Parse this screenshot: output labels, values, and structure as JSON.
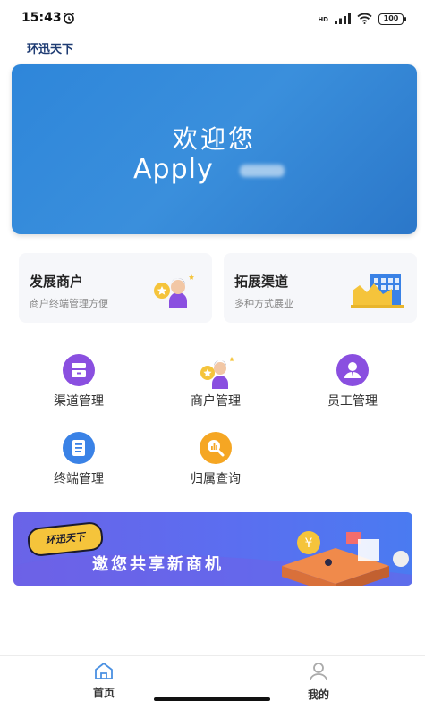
{
  "status_bar": {
    "time": "15:43",
    "network": "HD",
    "battery": "100"
  },
  "app": {
    "title": "环迅天下"
  },
  "hero": {
    "title": "欢迎您",
    "subtitle": "Apply"
  },
  "cards": [
    {
      "title": "发展商户",
      "desc": "商户终端管理方便",
      "icon": "merchant-person-icon"
    },
    {
      "title": "拓展渠道",
      "desc": "多种方式展业",
      "icon": "channel-building-icon"
    }
  ],
  "grid": [
    {
      "label": "渠道管理",
      "icon": "channel-manage-icon",
      "color": "#8a4fe0"
    },
    {
      "label": "商户管理",
      "icon": "merchant-manage-icon",
      "color": "#f5a623"
    },
    {
      "label": "员工管理",
      "icon": "staff-manage-icon",
      "color": "#8a4fe0"
    },
    {
      "label": "终端管理",
      "icon": "terminal-manage-icon",
      "color": "#3a82e6"
    },
    {
      "label": "归属查询",
      "icon": "ownership-query-icon",
      "color": "#f5a623"
    }
  ],
  "banner": {
    "badge": "环迅天下",
    "text": "邀您共享新商机"
  },
  "tabbar": [
    {
      "label": "首页",
      "icon": "home-icon",
      "active": true
    },
    {
      "label": "我的",
      "icon": "profile-icon",
      "active": false
    }
  ],
  "colors": {
    "hero_blue": "#2e86da",
    "brand_navy": "#1f3c73",
    "tab_active": "#4a90e2"
  }
}
